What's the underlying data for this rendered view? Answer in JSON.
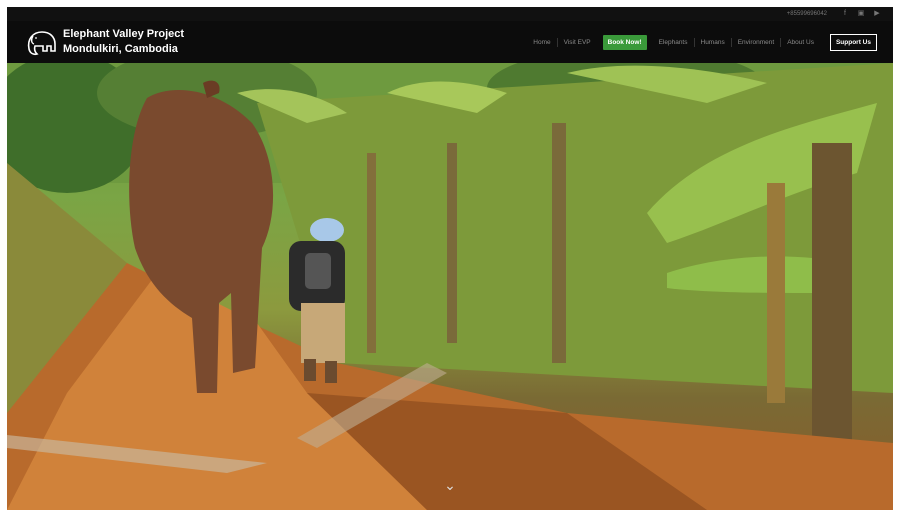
{
  "utility": {
    "phone": "+85599696042",
    "social_icons": [
      "facebook-icon",
      "instagram-icon",
      "youtube-icon"
    ]
  },
  "logo": {
    "line1": "Elephant Valley Project",
    "line2": "Mondulkiri, Cambodia",
    "icon": "elephant-icon"
  },
  "nav": {
    "home": "Home",
    "visit": "Visit EVP",
    "book": "Book Now!",
    "elephants": "Elephants",
    "humans": "Humans",
    "environment": "Environment",
    "about": "About Us",
    "support": "Support Us"
  },
  "hero": {
    "scroll_icon": "chevron-down-icon"
  },
  "colors": {
    "header_bg": "#0c0c0c",
    "book_button": "#3a9a3a",
    "nav_text": "#8a8a8a"
  }
}
